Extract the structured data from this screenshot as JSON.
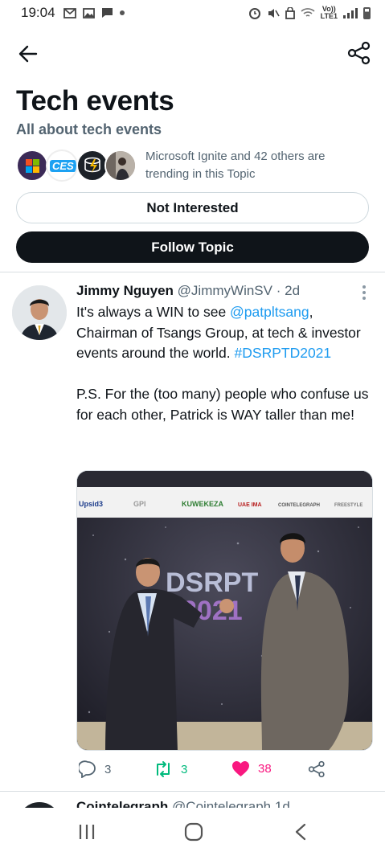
{
  "status_bar": {
    "time": "19:04",
    "network_label_top": "Vo))",
    "network_label_bottom": "LTE1"
  },
  "header": {
    "back_icon": "arrow-left-icon",
    "share_icon": "share-icon"
  },
  "topic": {
    "title": "Tech events",
    "subtitle": "All about tech events",
    "trending_text": "Microsoft Ignite and 42 others are trending in this Topic",
    "avatars": [
      "microsoft-logo",
      "ces-logo",
      "crypto-logo",
      "person-photo"
    ],
    "ces_label": "CES"
  },
  "buttons": {
    "not_interested": "Not Interested",
    "follow_topic": "Follow Topic"
  },
  "tweet": {
    "author_name": "Jimmy Nguyen",
    "author_handle": "@JimmyWinSV",
    "separator": "·",
    "time": "2d",
    "text_part1": "It's always a WIN to see ",
    "mention": "@patpltsang",
    "text_part2": ", Chairman of Tsangs Group, at tech & investor events around the world.",
    "hashtag": "#DSRPTD2021",
    "text_part3": "P.S. For the (too many) people who confuse us for each other, Patrick is WAY taller than me!",
    "stats": {
      "replies": "3",
      "retweets": "3",
      "likes": "38"
    },
    "media": {
      "banner_logos": [
        "Upsid3",
        "GPI",
        "KUWEKEZA",
        "UAE IMA",
        "COINTELEGRAPH",
        "FREESTYLE"
      ],
      "backdrop_text": "DSRPT",
      "backdrop_text_2": "2021"
    }
  },
  "next_tweet_peek": {
    "author_name": "Cointelegraph",
    "author_handle": "@Cointelegraph",
    "time": "1d"
  },
  "colors": {
    "primary_text": "#0f1419",
    "secondary_text": "#536471",
    "link": "#1d9bf0",
    "retweet": "#00ba7c",
    "like": "#f91880"
  }
}
